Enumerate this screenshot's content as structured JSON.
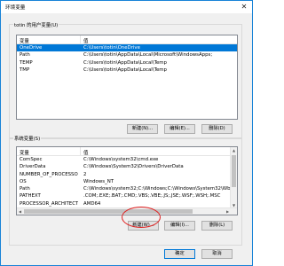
{
  "window": {
    "title": "环境变量",
    "close_glyph": "✕"
  },
  "user_section": {
    "label": "totin 的用户变量(U)",
    "columns": [
      "变量",
      "值"
    ],
    "rows": [
      {
        "name": "OneDrive",
        "value": "C:\\Users\\totin\\OneDrive",
        "selected": true
      },
      {
        "name": "Path",
        "value": "C:\\Users\\totin\\AppData\\Local\\Microsoft\\WindowsApps;"
      },
      {
        "name": "TEMP",
        "value": "C:\\Users\\totin\\AppData\\Local\\Temp"
      },
      {
        "name": "TMP",
        "value": "C:\\Users\\totin\\AppData\\Local\\Temp"
      }
    ],
    "buttons": {
      "new": "新建(N)...",
      "edit": "编辑(E)...",
      "delete": "删除(D)"
    }
  },
  "system_section": {
    "label": "系统变量(S)",
    "columns": [
      "变量",
      "值"
    ],
    "rows": [
      {
        "name": "ComSpec",
        "value": "C:\\Windows\\system32\\cmd.exe"
      },
      {
        "name": "DriverData",
        "value": "C:\\Windows\\System32\\Drivers\\DriverData"
      },
      {
        "name": "NUMBER_OF_PROCESSORS",
        "value": "2"
      },
      {
        "name": "OS",
        "value": "Windows_NT"
      },
      {
        "name": "Path",
        "value": "C:\\Windows\\system32;C:\\Windows;C:\\Windows\\System32\\Wb..."
      },
      {
        "name": "PATHEXT",
        "value": ".COM;.EXE;.BAT;.CMD;.VBS;.VBE;.JS;.JSE;.WSF;.WSH;.MSC"
      },
      {
        "name": "PROCESSOR_ARCHITECT...",
        "value": "AMD64"
      }
    ],
    "buttons": {
      "new": "新建(W)...",
      "edit": "编辑(I)...",
      "delete": "删除(L)"
    }
  },
  "footer": {
    "ok": "确定",
    "cancel": "取消"
  },
  "colors": {
    "accent": "#0078d7",
    "highlight_circle": "#e02020"
  }
}
